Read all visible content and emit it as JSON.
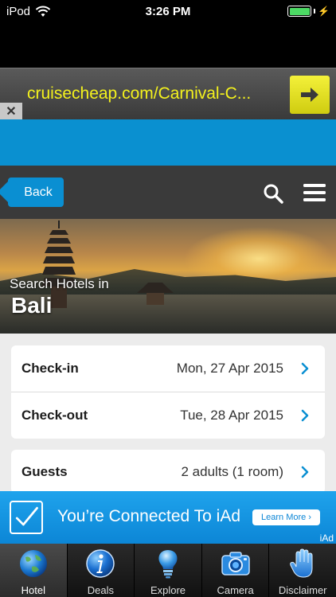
{
  "status_bar": {
    "carrier": "iPod",
    "time": "3:26 PM"
  },
  "ad_banner": {
    "text": "cruisecheap.com/Carnival-C...",
    "close_label": "✕",
    "text_color": "#f4f21d"
  },
  "nav": {
    "back_label": "Back",
    "accent": "#0a8fd2"
  },
  "hero": {
    "subtitle": "Search Hotels in",
    "title": "Bali"
  },
  "form": {
    "checkin": {
      "label": "Check-in",
      "value": "Mon, 27 Apr 2015"
    },
    "checkout": {
      "label": "Check-out",
      "value": "Tue, 28 Apr 2015"
    },
    "guests": {
      "label": "Guests",
      "value": "2 adults (1 room)"
    }
  },
  "iad": {
    "text": "You’re Connected To iAd",
    "learn_more": "Learn More ›",
    "label": "iAd",
    "color": "#1fa3ec"
  },
  "tabs": [
    {
      "label": "Hotel",
      "icon": "globe-icon",
      "active": true
    },
    {
      "label": "Deals",
      "icon": "info-icon",
      "active": false
    },
    {
      "label": "Explore",
      "icon": "lightbulb-icon",
      "active": false
    },
    {
      "label": "Camera",
      "icon": "camera-icon",
      "active": false
    },
    {
      "label": "Disclaimer",
      "icon": "hand-icon",
      "active": false
    }
  ]
}
